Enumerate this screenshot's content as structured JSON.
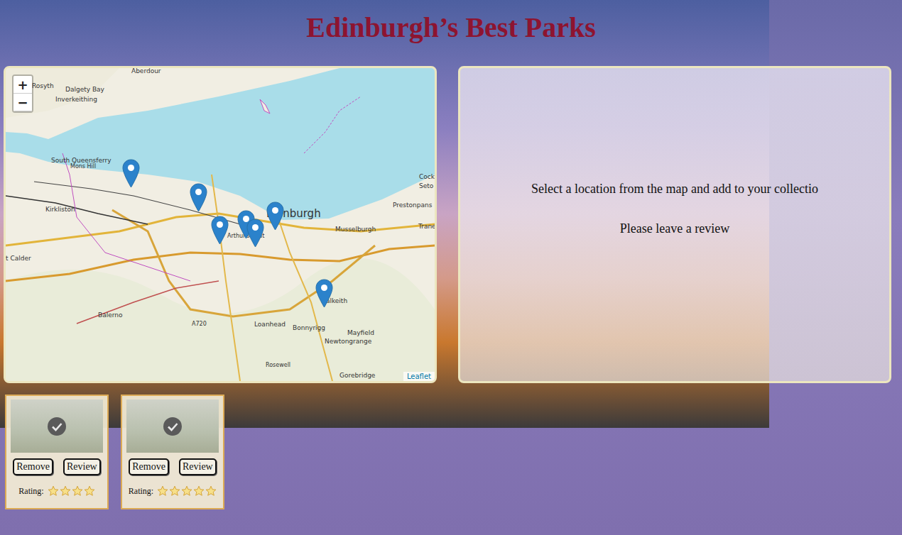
{
  "page": {
    "title": "Edinburgh’s Best Parks"
  },
  "map": {
    "zoom_in": "+",
    "zoom_out": "−",
    "attribution": "Leaflet",
    "labels": [
      "Aberdour",
      "Rosyth",
      "Dalgety Bay",
      "Inverkeithing",
      "South Queensferry",
      "Mons Hill",
      "Kirkliston",
      "Edinburgh",
      "Arthur's Seat",
      "Prestonpans",
      "Musselburgh",
      "Cock",
      "Seto",
      "Trane",
      "t Calder",
      "Balerno",
      "Loanhead",
      "Bonnyrigg",
      "Dalkeith",
      "Mayfield",
      "Newtongrange",
      "Rosewell",
      "Gorebridge",
      "A720"
    ]
  },
  "info_panel": {
    "lines": [
      "Select a location from the map and add to your collectio",
      "Please leave a review"
    ]
  },
  "collection": [
    {
      "checked": true,
      "buttons": [
        "Remove",
        "Review"
      ],
      "rating_label": "Rating:",
      "stars": 4
    },
    {
      "checked": true,
      "buttons": [
        "Remove",
        "Review"
      ],
      "rating_label": "Rating:",
      "stars": 5
    }
  ]
}
